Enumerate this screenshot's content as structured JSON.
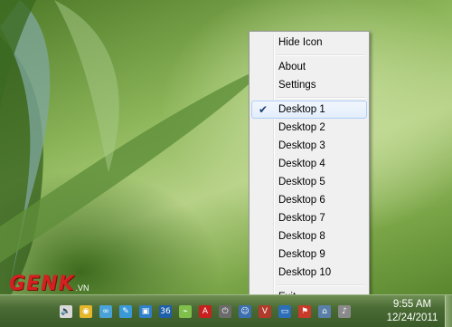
{
  "menu": {
    "items": [
      {
        "label": "Hide Icon"
      },
      {
        "label": "About"
      },
      {
        "label": "Settings"
      },
      {
        "label": "Desktop 1",
        "checked": true
      },
      {
        "label": "Desktop 2"
      },
      {
        "label": "Desktop 3"
      },
      {
        "label": "Desktop 4"
      },
      {
        "label": "Desktop 5"
      },
      {
        "label": "Desktop 6"
      },
      {
        "label": "Desktop 7"
      },
      {
        "label": "Desktop 8"
      },
      {
        "label": "Desktop 9"
      },
      {
        "label": "Desktop 10"
      },
      {
        "label": "Exit"
      }
    ],
    "check_glyph": "✔"
  },
  "taskbar": {
    "time": "9:55 AM",
    "date": "12/24/2011",
    "tray_icons": [
      {
        "name": "volume-icon",
        "color": "#d9d9d9",
        "glyph": "🔈"
      },
      {
        "name": "antivirus-icon",
        "color": "#e4b62a",
        "glyph": "◉"
      },
      {
        "name": "network-link-icon",
        "color": "#4aa3d8",
        "glyph": "∞"
      },
      {
        "name": "pen-icon",
        "color": "#3a9ad9",
        "glyph": "✎"
      },
      {
        "name": "display-icon",
        "color": "#2f7fc9",
        "glyph": "▣"
      },
      {
        "name": "app-36-icon",
        "color": "#1d5fa8",
        "glyph": "36"
      },
      {
        "name": "usb-icon",
        "color": "#7fbf4a",
        "glyph": "⌁"
      },
      {
        "name": "acrobat-icon",
        "color": "#c8201e",
        "glyph": "A"
      },
      {
        "name": "power-icon",
        "color": "#6b6b6b",
        "glyph": "⏻"
      },
      {
        "name": "user-icon",
        "color": "#3c6fb0",
        "glyph": "☺"
      },
      {
        "name": "v-app-icon",
        "color": "#b23a2a",
        "glyph": "V"
      },
      {
        "name": "monitor-icon",
        "color": "#2c6fb8",
        "glyph": "▭"
      },
      {
        "name": "flag-icon",
        "color": "#c83a2a",
        "glyph": "⚑"
      },
      {
        "name": "network-icon",
        "color": "#5a7fa8",
        "glyph": "⌂"
      },
      {
        "name": "speaker-icon",
        "color": "#8a8a8a",
        "glyph": "♪"
      }
    ]
  },
  "watermark": {
    "main": "GENK",
    "sub": ".VN"
  }
}
